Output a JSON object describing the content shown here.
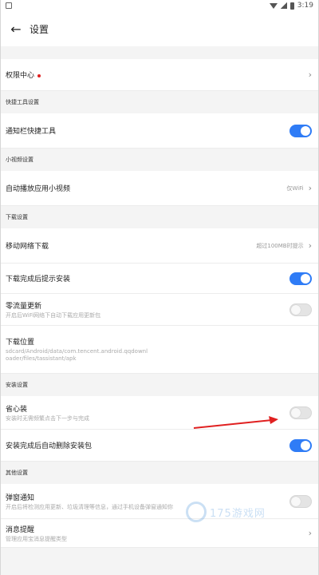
{
  "status_bar": {
    "time": "3:19"
  },
  "app_bar": {
    "title": "设置"
  },
  "rows": {
    "permission_center": {
      "label": "权限中心"
    },
    "notify_quick_tool": {
      "label": "通知栏快捷工具",
      "toggle": "on"
    },
    "autoplay_video": {
      "label": "自动播放应用小视频",
      "value": "仅WiFi"
    },
    "mobile_download": {
      "label": "移动网络下载",
      "value": "超过100MB时提示"
    },
    "install_prompt": {
      "label": "下载完成后提示安装",
      "toggle": "on"
    },
    "zero_traffic": {
      "label": "零流量更新",
      "sub": "开启后WiFi网络下自动下载应用更新包",
      "toggle": "off"
    },
    "download_location": {
      "label": "下载位置",
      "sub": "sdcard/Android/data/com.tencent.android.qqdownloader/files/tassistant/apk"
    },
    "easy_install": {
      "label": "省心装",
      "sub": "安装时无需频繁点击下一步与完成",
      "toggle": "off"
    },
    "auto_delete": {
      "label": "安装完成后自动删除安装包",
      "toggle": "on"
    },
    "popup_notify": {
      "label": "弹窗通知",
      "sub": "开启后将检测应用更新、垃圾清理等信息，通过手机设备弹窗通知你",
      "toggle": "off"
    },
    "message_reminder": {
      "label": "消息提醒",
      "sub": "管理应用宝消息提醒类型"
    }
  },
  "sections": {
    "quick_tools": "快捷工具设置",
    "short_video": "小视频设置",
    "download": "下载设置",
    "install": "安装设置",
    "other": "其他设置"
  },
  "watermark": {
    "text": "175游戏网"
  },
  "colors": {
    "toggle_on": "#2f7cf6",
    "toggle_off": "#e4e4e4",
    "dot": "#e02020",
    "arrow": "#e02020"
  }
}
